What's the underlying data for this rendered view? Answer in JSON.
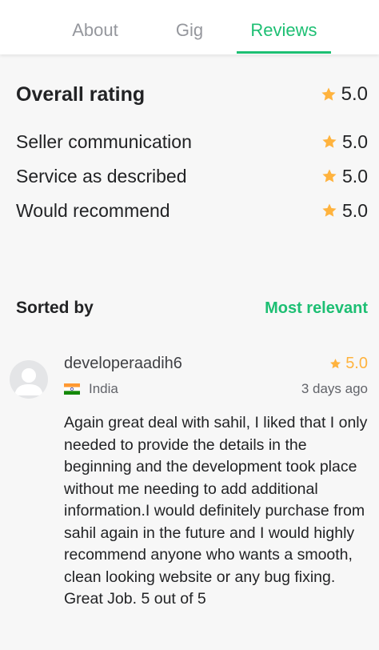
{
  "tabs": [
    {
      "label": "About"
    },
    {
      "label": "Gig"
    },
    {
      "label": "Reviews",
      "active": true
    }
  ],
  "overall": {
    "label": "Overall rating",
    "value": "5.0"
  },
  "breakdown": [
    {
      "label": "Seller communication",
      "value": "5.0"
    },
    {
      "label": "Service as described",
      "value": "5.0"
    },
    {
      "label": "Would recommend",
      "value": "5.0"
    }
  ],
  "sort": {
    "label": "Sorted by",
    "value": "Most relevant"
  },
  "review": {
    "username": "developeraadih6",
    "rating": "5.0",
    "country": "India",
    "time": "3 days ago",
    "text": "Again great deal with sahil, I liked that I only needed to provide the details in the beginning and the development took place without me needing to add additional information.I would definitely purchase from sahil again in the future and I would highly recommend anyone who wants a smooth, clean looking website or any bug fixing. Great Job. 5 out of 5"
  },
  "colors": {
    "accent": "#1dbf73",
    "star": "#ffb33e"
  },
  "icons": [
    "star-icon",
    "avatar-icon",
    "india-flag-icon"
  ]
}
